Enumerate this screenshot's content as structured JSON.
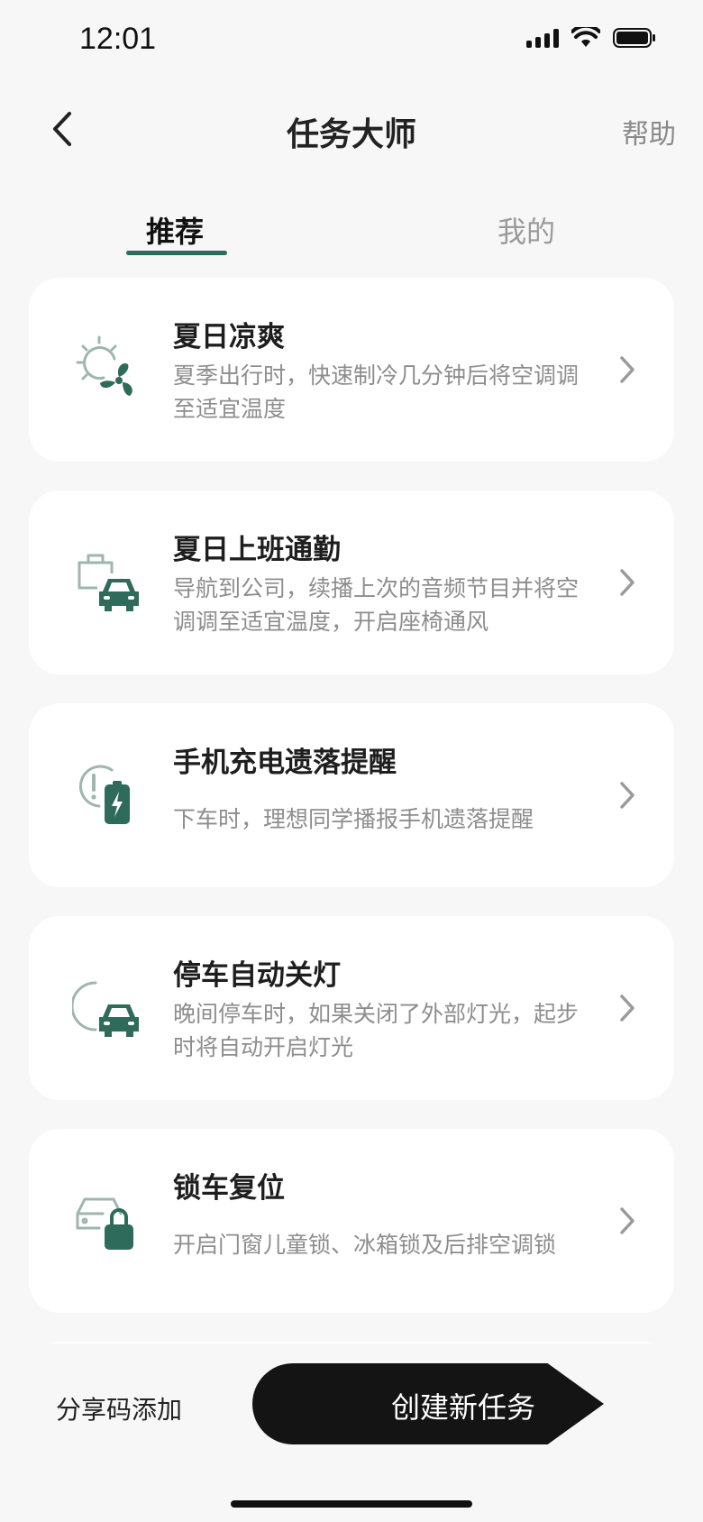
{
  "status_bar": {
    "time": "12:01"
  },
  "header": {
    "title": "任务大师",
    "help": "帮助"
  },
  "tabs": [
    {
      "label": "推荐",
      "active": true
    },
    {
      "label": "我的",
      "active": false
    }
  ],
  "cards": [
    {
      "title": "夏日凉爽",
      "desc": "夏季出行时，快速制冷几分钟后将空调调至适宜温度",
      "icon": "sun-fan-icon"
    },
    {
      "title": "夏日上班通勤",
      "desc": "导航到公司，续播上次的音频节目并将空调调至适宜温度，开启座椅通风",
      "icon": "briefcase-car-icon"
    },
    {
      "title": "手机充电遗落提醒",
      "desc": "下车时，理想同学播报手机遗落提醒",
      "icon": "phone-charge-alert-icon"
    },
    {
      "title": "停车自动关灯",
      "desc": "晚间停车时，如果关闭了外部灯光，起步时将自动开启灯光",
      "icon": "moon-car-icon"
    },
    {
      "title": "锁车复位",
      "desc": "开启门窗儿童锁、冰箱锁及后排空调锁",
      "icon": "car-lock-icon"
    }
  ],
  "bottom": {
    "share": "分享码添加",
    "create": "创建新任务"
  },
  "colors": {
    "accent": "#2e6b5a",
    "icon_light": "#9fb6ad",
    "button": "#141414"
  }
}
